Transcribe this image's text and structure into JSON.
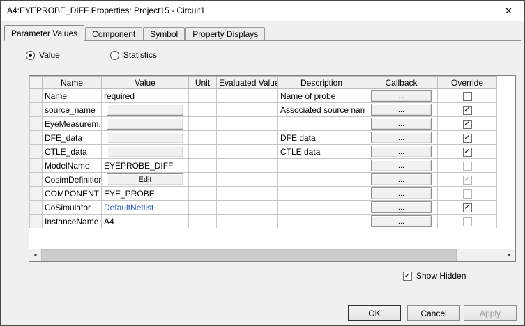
{
  "window": {
    "title": "A4:EYEPROBE_DIFF Properties: Project15 - Circuit1",
    "close_glyph": "✕"
  },
  "tabs": [
    {
      "label": "Parameter Values",
      "active": true
    },
    {
      "label": "Component",
      "active": false
    },
    {
      "label": "Symbol",
      "active": false
    },
    {
      "label": "Property Displays",
      "active": false
    }
  ],
  "radios": [
    {
      "label": "Value",
      "selected": true
    },
    {
      "label": "Statistics",
      "selected": false
    }
  ],
  "table": {
    "headers": [
      "Name",
      "Value",
      "Unit",
      "Evaluated Value",
      "Description",
      "Callback",
      "Override"
    ],
    "callback_label": "...",
    "rows": [
      {
        "name": "Name",
        "value": "required",
        "value_type": "text",
        "unit": "",
        "evaluated": "",
        "description": "Name of probe",
        "override": false,
        "override_disabled": false
      },
      {
        "name": "source_name",
        "value": "",
        "value_type": "field",
        "unit": "",
        "evaluated": "",
        "description": "Associated source name",
        "override": true,
        "override_disabled": false
      },
      {
        "name": "EyeMeasurem...",
        "value": "",
        "value_type": "field",
        "unit": "",
        "evaluated": "",
        "description": "",
        "override": true,
        "override_disabled": false
      },
      {
        "name": "DFE_data",
        "value": "",
        "value_type": "field",
        "unit": "",
        "evaluated": "",
        "description": "DFE data",
        "override": true,
        "override_disabled": false
      },
      {
        "name": "CTLE_data",
        "value": "",
        "value_type": "field",
        "unit": "",
        "evaluated": "",
        "description": "CTLE data",
        "override": true,
        "override_disabled": false
      },
      {
        "name": "ModelName",
        "value": "EYEPROBE_DIFF",
        "value_type": "text",
        "unit": "",
        "evaluated": "",
        "description": "",
        "override": false,
        "override_disabled": true
      },
      {
        "name": "CosimDefinition",
        "value": "Edit",
        "value_type": "button",
        "unit": "",
        "evaluated": "",
        "description": "",
        "override": true,
        "override_disabled": true
      },
      {
        "name": "COMPONENT",
        "value": "EYE_PROBE",
        "value_type": "text",
        "unit": "",
        "evaluated": "",
        "description": "",
        "override": false,
        "override_disabled": true
      },
      {
        "name": "CoSimulator",
        "value": "DefaultNetlist",
        "value_type": "link",
        "unit": "",
        "evaluated": "",
        "description": "",
        "override": true,
        "override_disabled": false
      },
      {
        "name": "InstanceName",
        "value": "A4",
        "value_type": "text",
        "unit": "",
        "evaluated": "",
        "description": "",
        "override": false,
        "override_disabled": true
      }
    ]
  },
  "footer": {
    "show_hidden_label": "Show Hidden",
    "show_hidden_checked": true,
    "ok_label": "OK",
    "cancel_label": "Cancel",
    "apply_label": "Apply"
  },
  "colors": {
    "link": "#2b5fc0",
    "dialog_bg": "#f0f0f0",
    "titlebar_bg": "#ffffff",
    "grid_line": "#c6c6c6"
  }
}
